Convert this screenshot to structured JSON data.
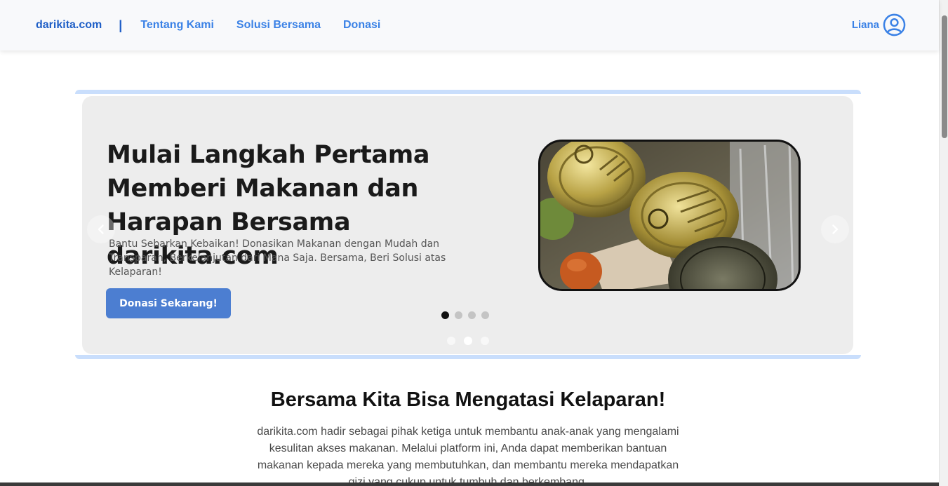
{
  "navbar": {
    "brand": "darikita.com",
    "separator": "|",
    "links": [
      "Tentang Kami",
      "Solusi Bersama",
      "Donasi"
    ],
    "user_name": "Liana",
    "avatar_icon": "user-circle-icon"
  },
  "hero": {
    "title": "Mulai Langkah Pertama Memberi Makanan dan Harapan Bersama darikita.com",
    "description": "Bantu Sebarkan Kebaikan! Donasikan Makanan dengan Mudah dan Transparan, Berkelanjutan dari Mana Saja. Bersama, Beri Solusi atas Kelaparan!",
    "button_label": "Donasi Sekarang!",
    "image_alt": "canned food photo",
    "inner_dots": {
      "count": 4,
      "active": 1
    },
    "outer_dots": {
      "count": 3,
      "active": 2
    },
    "prev_icon": "chevron-left-icon",
    "next_icon": "chevron-right-icon"
  },
  "section": {
    "title": "Bersama Kita Bisa Mengatasi Kelaparan!",
    "text": "darikita.com hadir sebagai pihak ketiga untuk membantu anak-anak yang mengalami kesulitan akses makanan. Melalui platform ini, Anda dapat memberikan bantuan makanan kepada mereka yang membutuhkan, dan membantu mereka mendapatkan gizi yang cukup untuk tumbuh dan berkembang."
  },
  "colors": {
    "accent": "#3b82e6",
    "brand": "#1f5fc7",
    "button": "#4c7ed1",
    "frame": "#c9defc"
  }
}
